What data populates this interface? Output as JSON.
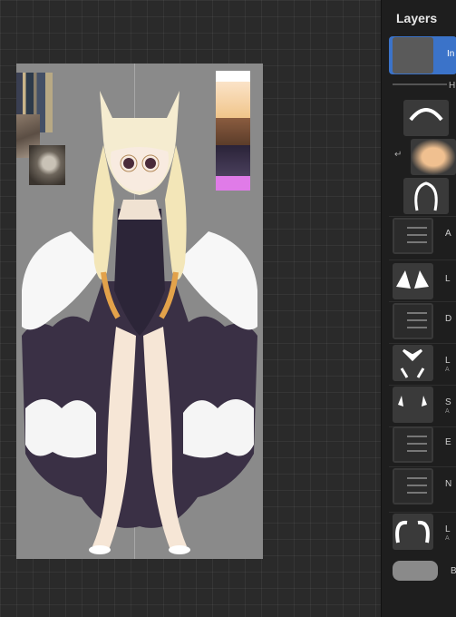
{
  "panel": {
    "title": "Layers"
  },
  "layers": [
    {
      "label": "In",
      "sub": "",
      "active": true
    },
    {
      "label": "H",
      "sub": "",
      "group_header": true
    },
    {
      "label": "",
      "sub": ""
    },
    {
      "label": "",
      "sub": ""
    },
    {
      "label": "",
      "sub": ""
    },
    {
      "label": "A",
      "sub": ""
    },
    {
      "label": "L",
      "sub": ""
    },
    {
      "label": "D",
      "sub": ""
    },
    {
      "label": "L",
      "sub": "A"
    },
    {
      "label": "S",
      "sub": "A"
    },
    {
      "label": "E",
      "sub": ""
    },
    {
      "label": "N",
      "sub": ""
    },
    {
      "label": "L",
      "sub": "A"
    }
  ],
  "background_layer": {
    "label": "Ba"
  },
  "palette": [
    "#ffffff",
    "#f0c58a",
    "#6e4a33",
    "#2a2338",
    "#4a3f5c",
    "#e07be8"
  ],
  "colors": {
    "canvas": "#8a8a8a",
    "active_layer": "#3b73c9",
    "panel_bg": "#1e1e1e"
  }
}
